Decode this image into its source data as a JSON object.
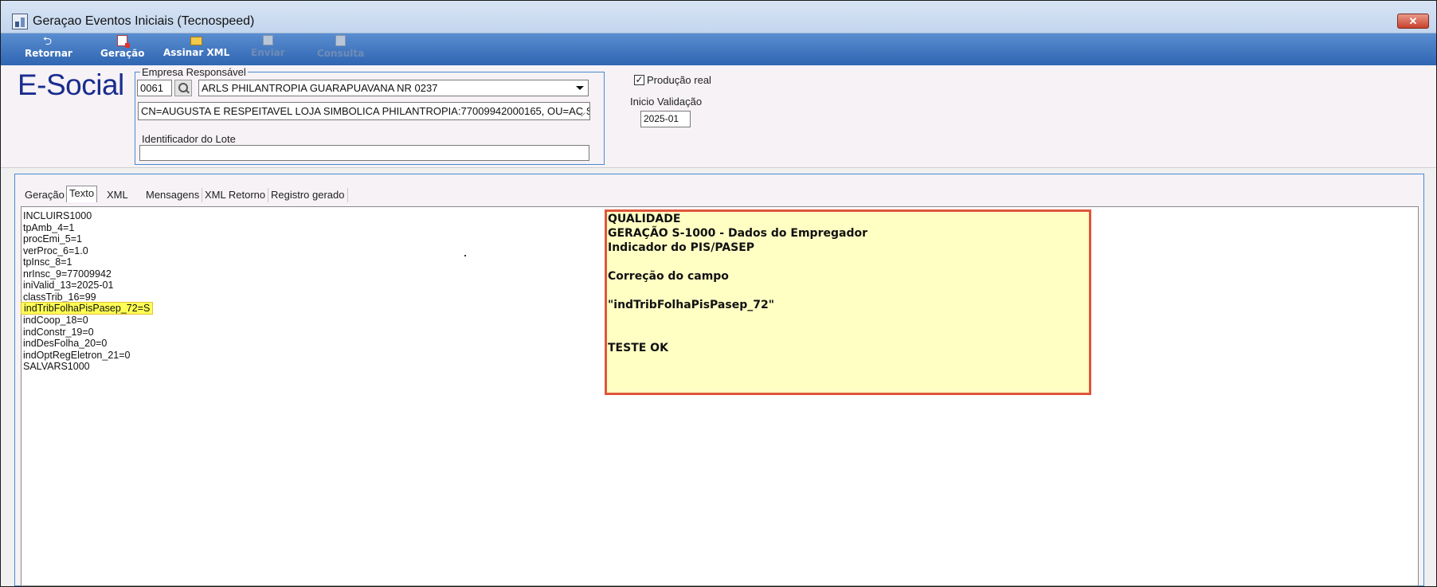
{
  "window": {
    "title": "Geraçao Eventos Iniciais (Tecnospeed)",
    "close_label": "✕"
  },
  "toolbar": {
    "buttons": [
      {
        "label": "Retornar",
        "icon": "return-icon",
        "enabled": true
      },
      {
        "label": "Geração",
        "icon": "document-icon",
        "enabled": true
      },
      {
        "label": "Assinar XML",
        "icon": "sign-icon",
        "enabled": true
      },
      {
        "label": "Enviar",
        "icon": "send-icon",
        "enabled": false
      },
      {
        "label": "Consulta",
        "icon": "query-icon",
        "enabled": false
      }
    ]
  },
  "header": {
    "brand": "E-Social",
    "group_label": "Empresa Responsável",
    "company_code": "0061",
    "company_name": "ARLS PHILANTROPIA GUARAPUAVANA NR 0237",
    "certificate": "CN=AUGUSTA E RESPEITAVEL LOJA SIMBOLICA PHILANTROPIA:77009942000165, OU=AC Syn",
    "batch_id_label": "Identificador do Lote",
    "batch_id_value": "",
    "production_label": "Produção real",
    "production_checked": true,
    "start_validation_label": "Inicio Validação",
    "start_validation_value": "2025-01"
  },
  "tabs": [
    {
      "label": "Geração",
      "active": false
    },
    {
      "label": "Texto",
      "active": true
    },
    {
      "label": "XML",
      "active": false
    },
    {
      "label": "Mensagens",
      "active": false
    },
    {
      "label": "XML Retorno",
      "active": false
    },
    {
      "label": "Registro gerado",
      "active": false
    }
  ],
  "text_lines": [
    "INCLUIRS1000",
    "tpAmb_4=1",
    "procEmi_5=1",
    "verProc_6=1.0",
    "tpInsc_8=1",
    "nrInsc_9=77009942",
    "iniValid_13=2025-01",
    "classTrib_16=99",
    "indTribFolhaPisPasep_72=S",
    "indCoop_18=0",
    "indConstr_19=0",
    "indDesFolha_20=0",
    "indOptRegEletron_21=0",
    "SALVARS1000"
  ],
  "note": {
    "lines": [
      "QUALIDADE",
      "GERAÇÃO S-1000 - Dados do Empregador",
      "Indicador do PIS/PASEP",
      "Correção do campo",
      "\"indTribFolhaPisPasep_72\"",
      "TESTE OK"
    ]
  },
  "colors": {
    "toolbar": "#2f66b2",
    "brand": "#1a2d8e",
    "highlight": "#ffff55",
    "note_bg": "#ffffc4",
    "note_border": "#e0553b"
  }
}
